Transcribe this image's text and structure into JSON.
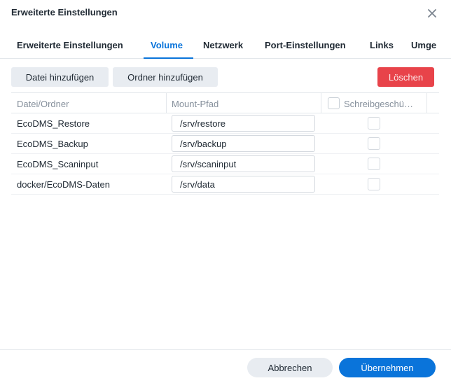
{
  "dialog": {
    "title": "Erweiterte Einstellungen"
  },
  "tabs": [
    {
      "label": "Erweiterte Einstellungen",
      "active": false
    },
    {
      "label": "Volume",
      "active": true
    },
    {
      "label": "Netzwerk",
      "active": false
    },
    {
      "label": "Port-Einstellungen",
      "active": false
    },
    {
      "label": "Links",
      "active": false
    },
    {
      "label": "Umge",
      "active": false
    }
  ],
  "toolbar": {
    "add_file_label": "Datei hinzufügen",
    "add_folder_label": "Ordner hinzufügen",
    "delete_label": "Löschen"
  },
  "table": {
    "columns": [
      "Datei/Ordner",
      "Mount-Pfad",
      "Schreibgeschü…"
    ],
    "rows": [
      {
        "name": "EcoDMS_Restore",
        "mount": "/srv/restore",
        "readonly": false
      },
      {
        "name": "EcoDMS_Backup",
        "mount": "/srv/backup",
        "readonly": false
      },
      {
        "name": "EcoDMS_Scaninput",
        "mount": "/srv/scaninput",
        "readonly": false
      },
      {
        "name": "docker/EcoDMS-Daten",
        "mount": "/srv/data",
        "readonly": false
      }
    ]
  },
  "footer": {
    "cancel_label": "Abbrechen",
    "apply_label": "Übernehmen"
  },
  "icons": {
    "close": "close-icon"
  },
  "colors": {
    "accent": "#0a74da",
    "danger": "#e8434a",
    "secondary_button": "#e8ecf1"
  }
}
